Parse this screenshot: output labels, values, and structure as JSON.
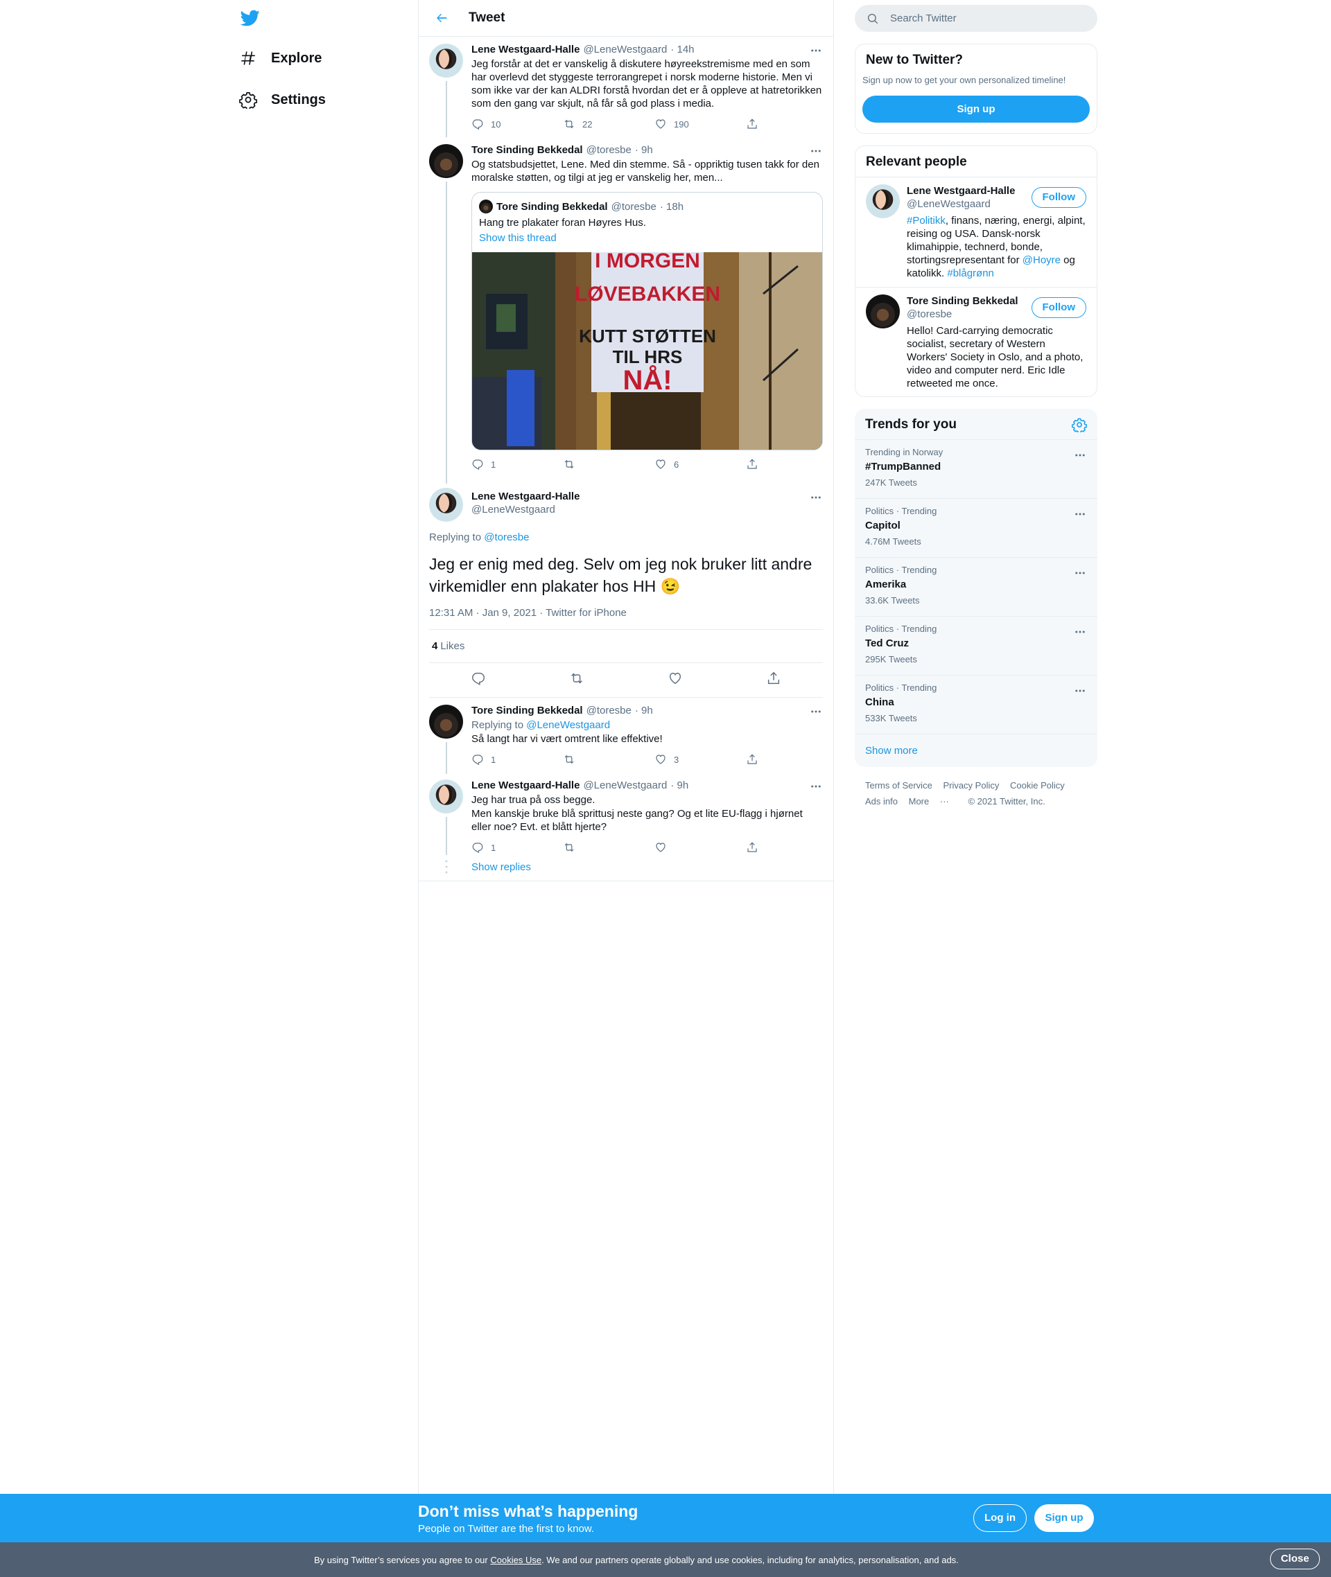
{
  "nav": {
    "explore": "Explore",
    "settings": "Settings"
  },
  "header": {
    "title": "Tweet"
  },
  "tweets": [
    {
      "name": "Lene Westgaard-Halle",
      "handle": "@LeneWestgaard",
      "time": "· 14h",
      "text": "Jeg forstår at det er vanskelig å diskutere høyreekstremisme med en som har overlevd det styggeste terrorangrepet i norsk moderne historie. Men vi som ikke var der kan ALDRI forstå hvordan det er å oppleve at hatretorikken som den gang var skjult, nå får så god plass i media.",
      "replies": "10",
      "retweets": "22",
      "likes": "190"
    },
    {
      "name": "Tore Sinding Bekkedal",
      "handle": "@toresbe",
      "time": "· 9h",
      "text": "Og statsbudsjettet, Lene. Med din stemme. Så - oppriktig tusen takk for den moralske støtten, og tilgi at jeg er vanskelig her, men...",
      "replies": "1",
      "retweets": "",
      "likes": "6",
      "quote": {
        "name": "Tore Sinding Bekkedal",
        "handle": "@toresbe",
        "time": "· 18h",
        "text": "Hang tre plakater foran Høyres Hus.",
        "link": "Show this thread",
        "poster_lines": [
          "I MORGEN",
          "LØVEBAKKEN",
          "KUTT STØTTEN",
          "TIL HRS",
          "NÅ!"
        ]
      }
    }
  ],
  "focus": {
    "name": "Lene Westgaard-Halle",
    "handle": "@LeneWestgaard",
    "replying_label": "Replying to",
    "replying_to": "@toresbe",
    "text": "Jeg er enig med deg. Selv om jeg nok bruker litt andre virkemidler enn plakater hos HH 😉",
    "meta": "12:31 AM · Jan 9, 2021 · Twitter for iPhone",
    "likes_count": "4",
    "likes_label": "Likes"
  },
  "replies": [
    {
      "name": "Tore Sinding Bekkedal",
      "handle": "@toresbe",
      "time": "· 9h",
      "replying_label": "Replying to",
      "replying_to": "@LeneWestgaard",
      "text": "Så langt har vi vært omtrent like effektive!",
      "replies": "1",
      "retweets": "",
      "likes": "3"
    },
    {
      "name": "Lene Westgaard-Halle",
      "handle": "@LeneWestgaard",
      "time": "· 9h",
      "text1": "Jeg har trua på oss begge.",
      "text2": "Men kanskje bruke blå sprittusj neste gang? Og et lite EU-flagg i hjørnet eller noe? Evt. et blått hjerte?",
      "replies": "1",
      "retweets": "",
      "likes": ""
    }
  ],
  "show_replies": "Show replies",
  "sidebar": {
    "search_placeholder": "Search Twitter",
    "new_title": "New to Twitter?",
    "new_sub": "Sign up now to get your own personalized timeline!",
    "signup": "Sign up",
    "relevant_title": "Relevant people",
    "follow": "Follow",
    "people": [
      {
        "name": "Lene Westgaard-Halle",
        "handle": "@LeneWestgaard",
        "bio_tag": "#Politikk",
        "bio_a": ", finans, næring, energi, alpint, reising og USA. Dansk-norsk klimahippie, technerd, bonde, stortingsrepresentant for ",
        "bio_mention": "@Hoyre",
        "bio_b": " og katolikk. ",
        "bio_tag2": "#blågrønn"
      },
      {
        "name": "Tore Sinding Bekkedal",
        "handle": "@toresbe",
        "bio": "Hello! Card-carrying democratic socialist, secretary of Western Workers' Society in Oslo, and a photo, video and computer nerd. Eric Idle retweeted me once."
      }
    ],
    "trends_title": "Trends for you",
    "trends": [
      {
        "context": "Trending in Norway",
        "name": "#TrumpBanned",
        "count": "247K Tweets"
      },
      {
        "context": "Politics · Trending",
        "name": "Capitol",
        "count": "4.76M Tweets"
      },
      {
        "context": "Politics · Trending",
        "name": "Amerika",
        "count": "33.6K Tweets"
      },
      {
        "context": "Politics · Trending",
        "name": "Ted Cruz",
        "count": "295K Tweets"
      },
      {
        "context": "Politics · Trending",
        "name": "China",
        "count": "533K Tweets"
      }
    ],
    "show_more": "Show more",
    "footer": {
      "terms": "Terms of Service",
      "privacy": "Privacy Policy",
      "cookie": "Cookie Policy",
      "ads": "Ads info",
      "more": "More",
      "copyright": "© 2021 Twitter, Inc."
    }
  },
  "bottom_bar": {
    "title": "Don’t miss what’s happening",
    "subtitle": "People on Twitter are the first to know.",
    "login": "Log in",
    "signup": "Sign up"
  },
  "cookie_bar": {
    "prefix": "By using Twitter’s services you agree to our ",
    "link": "Cookies Use",
    "suffix": ". We and our partners operate globally and use cookies, including for analytics, personalisation, and ads.",
    "close": "Close"
  },
  "colors": {
    "accent": "#1da1f2",
    "link": "#1b95e0",
    "muted": "#5b7083"
  }
}
